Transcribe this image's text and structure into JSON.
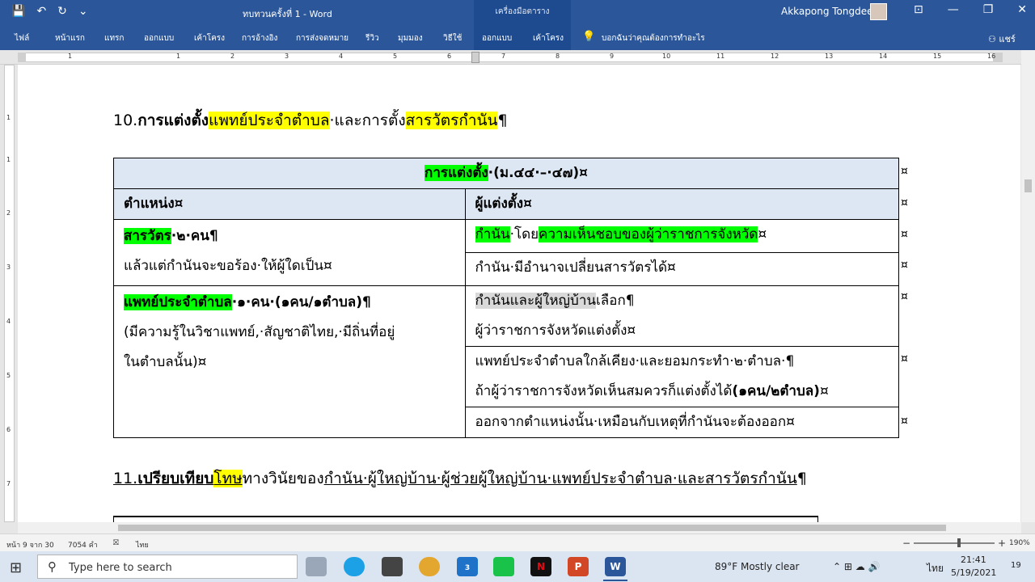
{
  "titlebar": {
    "doc_title": "ทบทวนครั้งที่ 1 - Word",
    "context_tab": "เครื่องมือตาราง",
    "user_name": "Akkapong Tongdee",
    "save_icon": "💾",
    "undo_icon": "↶",
    "redo_icon": "↻",
    "customize_icon": "⌄",
    "ribbon_display_icon": "⊡",
    "minimize_icon": "—",
    "maximize_icon": "❐",
    "close_icon": "✕"
  },
  "ribbon": {
    "tabs": [
      "ไฟล์",
      "หน้าแรก",
      "แทรก",
      "ออกแบบ",
      "เค้าโครง",
      "การอ้างอิง",
      "การส่งจดหมาย",
      "รีวิว",
      "มุมมอง",
      "วิธีใช้",
      "ออกแบบ",
      "เค้าโครง"
    ],
    "tell_me": "บอกฉันว่าคุณต้องการทำอะไร",
    "share": "แชร์",
    "bulb_icon": "💡",
    "share_icon": "⚇"
  },
  "ruler": {
    "numbers": [
      "1",
      "1",
      "2",
      "3",
      "4",
      "5",
      "6",
      "7",
      "8",
      "9",
      "10",
      "11",
      "12",
      "13",
      "14",
      "15",
      "16"
    ],
    "vnumbers": [
      "1",
      "1",
      "2",
      "3",
      "4",
      "5",
      "6",
      "7"
    ]
  },
  "document": {
    "heading10": {
      "num": "10.",
      "part1": "การแต่งตั้ง",
      "part2": "แพทย์ประจำตำบล",
      "part3": "·และการตั้ง",
      "part4": "สารวัตรกำนัน",
      "pilcrow": "¶"
    },
    "table": {
      "title_hl": "การแต่งตั้ง",
      "title_rest": "·(ม.๔๔·–·๔๗)¤",
      "col1": "ตำแหน่ง¤",
      "col2": "ผู้แต่งตั้ง¤",
      "r1c1_hl": "สารวัตร",
      "r1c1_rest": "·๒·คน¶",
      "r1c1_line2": "แล้วแต่กำนันจะขอร้อง·ให้ผู้ใดเป็น¤",
      "r1a_c2_hl1": "กำนัน",
      "r1a_c2_mid": "·โดย",
      "r1a_c2_hl2": "ความเห็นชอบของผู้ว่าราชการจังหวัด",
      "r1a_c2_end": "¤",
      "r1b_c2": "กำนัน·มีอำนาจเปลี่ยนสารวัตรได้¤",
      "r2c1_hl": "แพทย์ประจำตำบล",
      "r2c1_rest": "·๑·คน·(๑คน/๑ตำบล)¶",
      "r2c1_line2": "(มีความรู้ในวิชาแพทย์,·สัญชาติไทย,·มีถิ่นที่อยู่",
      "r2c1_line3": "ในตำบลนั้น)¤",
      "r2a_c2_hl": "กำนันและผู้ใหญ่บ้าน",
      "r2a_c2_rest": "เลือก¶",
      "r2a_c2_line2": "ผู้ว่าราชการจังหวัดแต่งตั้ง¤",
      "r2b_c2_line1": "แพทย์ประจำตำบลใกล้เคียง·และยอมกระทำ·๒·ตำบล·¶",
      "r2b_c2_line2a": "ถ้าผู้ว่าราชการจังหวัดเห็นสมควรก็แต่งตั้งได้",
      "r2b_c2_line2b": "(๑คน/๒ตำบล)",
      "r2b_c2_line2c": "¤",
      "r2c_c2": "ออกจากตำแหน่งนั้น·เหมือนกับเหตุที่กำนันจะต้องออก¤",
      "row_end_mark": "¤"
    },
    "heading11": {
      "num": "11.",
      "bold1": "เปรียบเทียบ",
      "hl": "โทษ",
      "rest1": "ทางวินัยของ",
      "rest2": "กำนัน·ผู้ใหญ่บ้าน·ผู้ช่วยผู้ใหญ่บ้าน·แพทย์ประจำตำบล·และสารวัตรกำนัน",
      "pilcrow": "¶"
    }
  },
  "status": {
    "page": "หน้า 9 จาก 30",
    "words": "7054 คำ",
    "lang": "ไทย",
    "zoom_minus": "−",
    "zoom_plus": "+",
    "zoom": "190%",
    "proofing_icon": "⛝"
  },
  "taskbar": {
    "start_icon": "⊞",
    "search_icon": "⚲",
    "search_placeholder": "Type here to search",
    "apps": [
      "Task View",
      "Edge",
      "Store",
      "Chrome",
      "Mail",
      "LINE",
      "Netflix",
      "PowerPoint",
      "Word"
    ],
    "mail_badge": "3",
    "weather": "89°F  Mostly clear",
    "tray_icons": "⌃  ⊞  ☁  🔊",
    "lang": "ไทย",
    "time": "21:41",
    "date": "5/19/2021",
    "notif": "19"
  },
  "colors": {
    "word_blue": "#2b579a",
    "highlight_yellow": "#ffff00",
    "highlight_green": "#00ff00",
    "table_header": "#dde7f3"
  }
}
